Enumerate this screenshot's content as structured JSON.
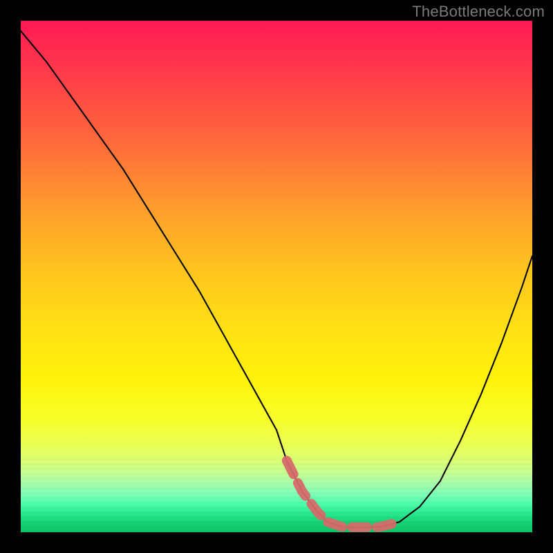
{
  "watermark": "TheBottleneck.com",
  "chart_data": {
    "type": "line",
    "title": "",
    "xlabel": "",
    "ylabel": "",
    "xlim": [
      0,
      100
    ],
    "ylim": [
      0,
      100
    ],
    "grid": false,
    "legend": false,
    "background": {
      "type": "vertical-gradient",
      "stops": [
        {
          "pos": 0,
          "color": "#ff1a55"
        },
        {
          "pos": 50,
          "color": "#ffd018"
        },
        {
          "pos": 85,
          "color": "#f2ff4a"
        },
        {
          "pos": 100,
          "color": "#10c468"
        }
      ]
    },
    "series": [
      {
        "name": "bottleneck-curve",
        "color": "#000000",
        "x": [
          0,
          5,
          10,
          15,
          20,
          25,
          30,
          35,
          40,
          45,
          50,
          52,
          55,
          58,
          60,
          63,
          66,
          70,
          74,
          78,
          82,
          86,
          90,
          94,
          98,
          100
        ],
        "values": [
          98,
          92,
          85,
          78,
          71,
          63,
          55,
          47,
          38,
          29,
          20,
          14,
          8,
          4,
          2,
          1,
          1,
          1,
          2,
          5,
          10,
          18,
          27,
          37,
          48,
          54
        ]
      },
      {
        "name": "highlight-band",
        "color": "#d66a6a",
        "style": "thick-dashed",
        "x": [
          52,
          55,
          58,
          60,
          63,
          66,
          70,
          74
        ],
        "values": [
          14,
          8,
          4,
          2,
          1,
          1,
          1,
          2
        ]
      }
    ]
  }
}
